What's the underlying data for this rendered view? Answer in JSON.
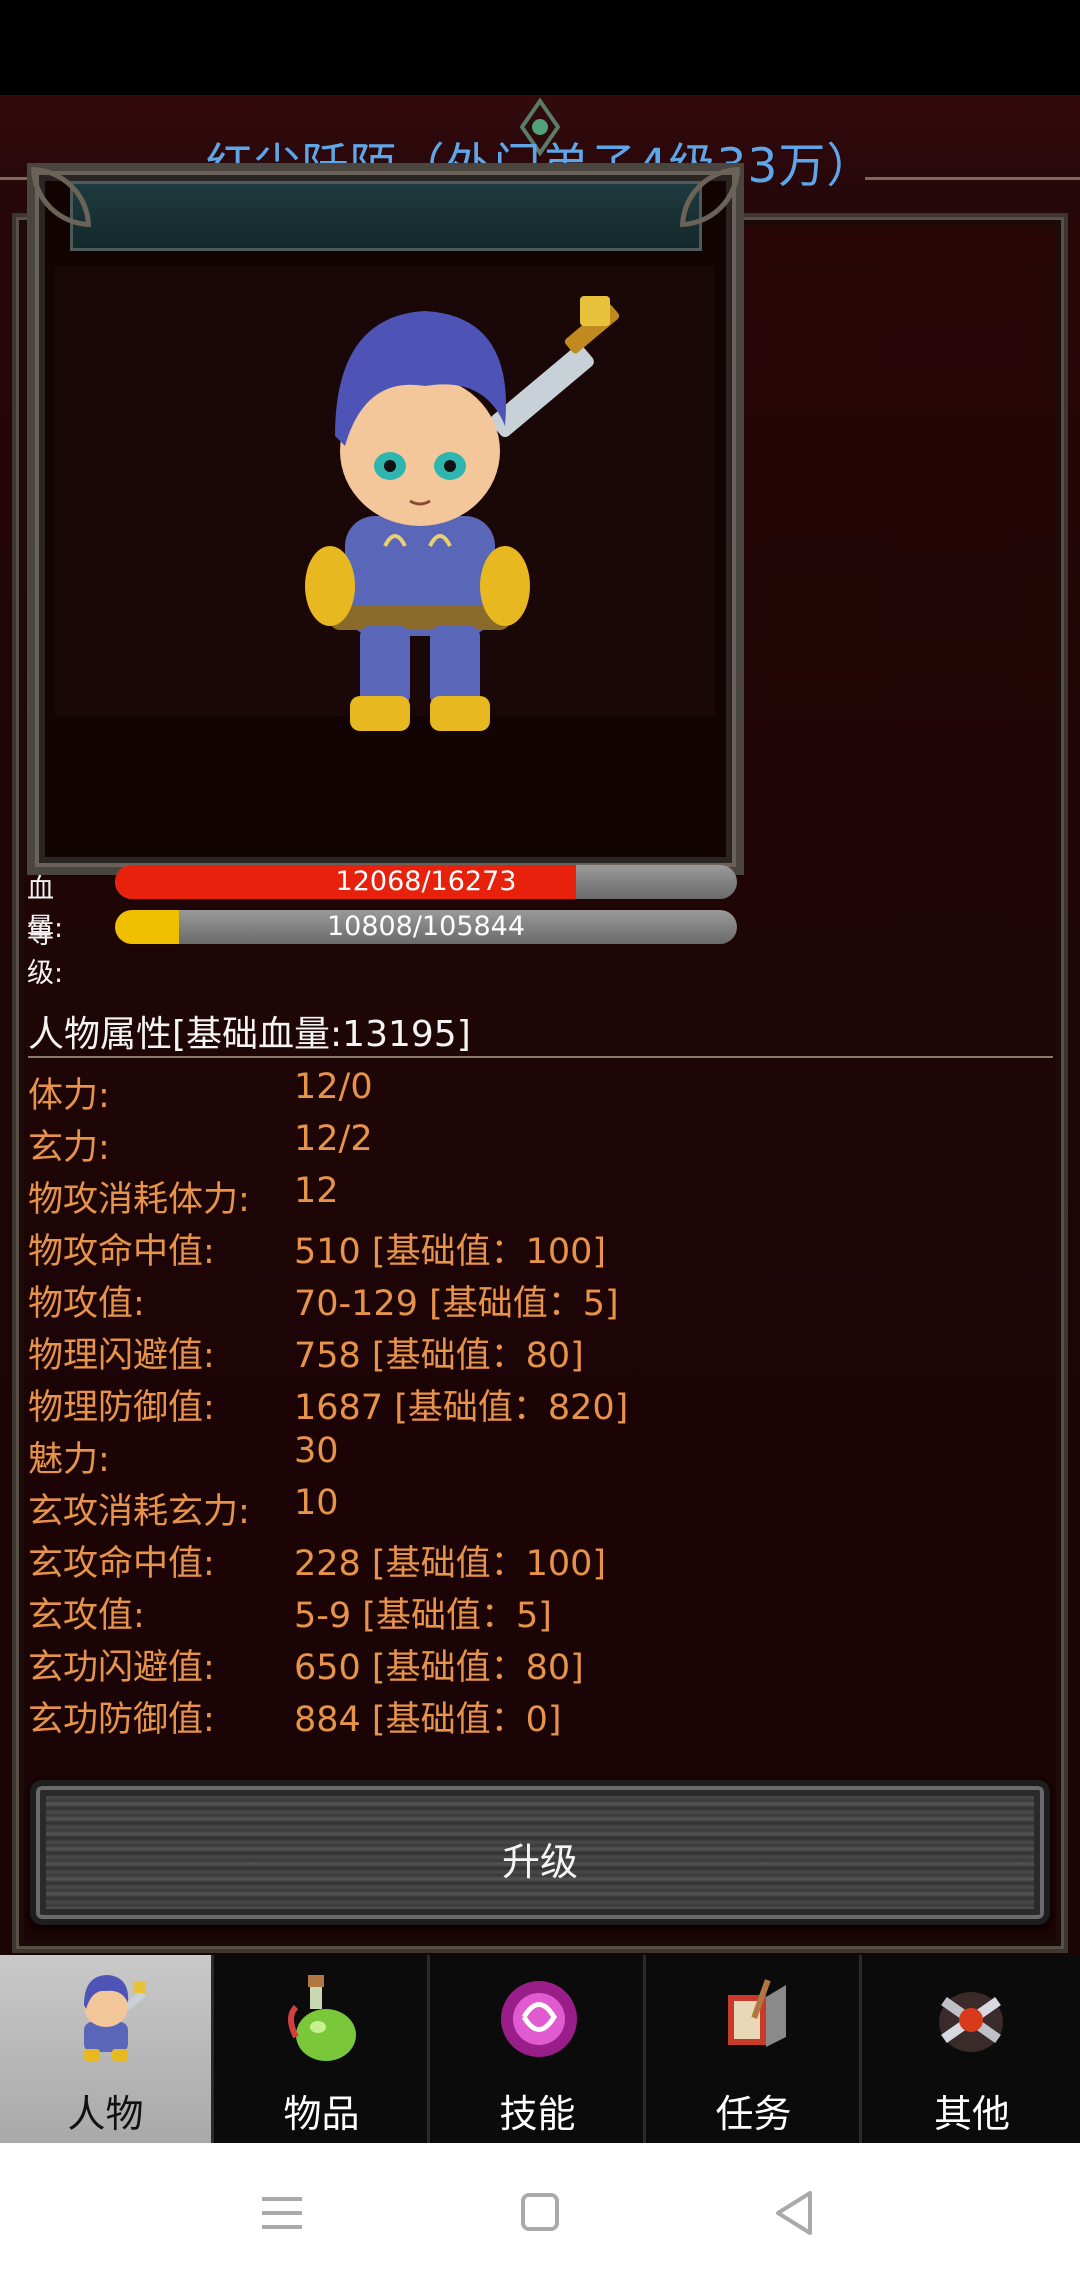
{
  "header": {
    "title": "红尘阡陌（外门弟子4级33万）"
  },
  "character": {
    "hp_label": "血量:",
    "hp_text": "12068/16273",
    "hp_fraction": 0.7416,
    "hp_color": "#e8210c",
    "level_label": "等级:",
    "level_text": "10808/105844",
    "level_fraction": 0.1021,
    "level_color": "#f0c000"
  },
  "attributes": {
    "heading": "人物属性[基础血量:13195]",
    "rows": [
      {
        "name": "体力:",
        "value": "12/0"
      },
      {
        "name": "玄力:",
        "value": "12/2"
      },
      {
        "name": "物攻消耗体力:",
        "value": "12"
      },
      {
        "name": "物攻命中值:",
        "value": "510 [基础值：100]"
      },
      {
        "name": "物攻值:",
        "value": "70-129 [基础值：5]"
      },
      {
        "name": "物理闪避值:",
        "value": "758 [基础值：80]"
      },
      {
        "name": "物理防御值:",
        "value": "1687 [基础值：820]"
      },
      {
        "name": "魅力:",
        "value": "30"
      },
      {
        "name": "玄攻消耗玄力:",
        "value": "10"
      },
      {
        "name": "玄攻命中值:",
        "value": "228 [基础值：100]"
      },
      {
        "name": "玄攻值:",
        "value": "5-9 [基础值：5]"
      },
      {
        "name": "玄功闪避值:",
        "value": "650 [基础值：80]"
      },
      {
        "name": "玄功防御值:",
        "value": "884 [基础值：0]"
      }
    ]
  },
  "actions": {
    "upgrade_label": "升级"
  },
  "tabs": [
    {
      "label": "人物",
      "icon": "character-icon",
      "active": true
    },
    {
      "label": "物品",
      "icon": "potion-icon",
      "active": false
    },
    {
      "label": "技能",
      "icon": "skill-orb-icon",
      "active": false
    },
    {
      "label": "任务",
      "icon": "quest-book-icon",
      "active": false
    },
    {
      "label": "其他",
      "icon": "crossed-swords-icon",
      "active": false
    }
  ],
  "system_nav": {
    "menu_icon": "menu-icon",
    "home_icon": "home-square-icon",
    "back_icon": "back-triangle-icon"
  }
}
